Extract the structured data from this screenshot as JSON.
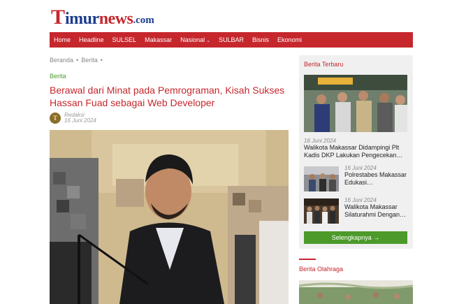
{
  "site": {
    "logo_parts": [
      "T",
      "imur",
      "news",
      ".com"
    ]
  },
  "nav": {
    "items": [
      "Home",
      "Headline",
      "SULSEL",
      "Makassar",
      "Nasional",
      "SULBAR",
      "Bisnis",
      "Ekonomi"
    ],
    "dropdown_caret": "⌄"
  },
  "breadcrumb": {
    "items": [
      "Beranda",
      "Berita"
    ],
    "separator": "•"
  },
  "article": {
    "category": "Berita",
    "title": "Berawal dari Minat pada Pemrograman, Kisah Sukses Hassan Fuad sebagai Web Developer",
    "author": "Redaksi",
    "date": "16 Juni 2024",
    "avatar_letter": "T"
  },
  "sidebar": {
    "section_title": "Berita Terbaru",
    "featured": {
      "date": "16 Juni 2024",
      "headline": "Walikota Makassar Didampingi Plt Kadis DKP Lakukan Pengecekan…"
    },
    "items": [
      {
        "date": "16 Juni 2024",
        "headline": "Polrestabes Makassar Edukasi…"
      },
      {
        "date": "16 Juni 2024",
        "headline": "Walikota Makassar Silaturahmi Dengan…"
      }
    ],
    "more_button": "Selengkapnya →",
    "sport_title": "Berita Olahraga"
  },
  "colors": {
    "brand_red": "#c5272d",
    "brand_blue": "#1d3c8f",
    "accent_green": "#4c9a2a"
  }
}
